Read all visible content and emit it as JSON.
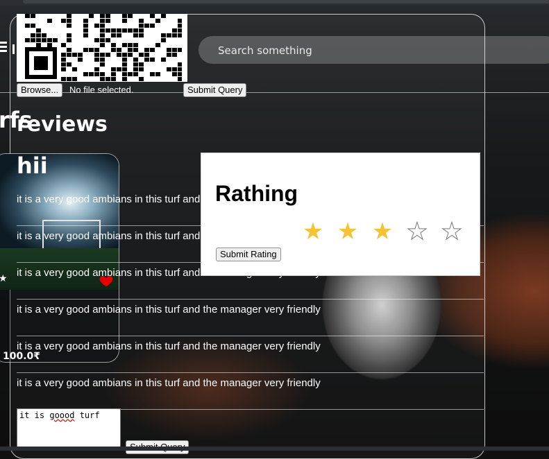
{
  "header": {
    "search_placeholder": "Search something"
  },
  "upload": {
    "browse_label": "Browse...",
    "file_status": "No file selected.",
    "submit_label": "Submit Query"
  },
  "sections": {
    "turfs_title": "rfs",
    "reviews_title": "reviews"
  },
  "turf": {
    "name": "hii",
    "price": "100.0₹",
    "favorite_icon": "heart-icon"
  },
  "reviews": [
    {
      "text": "it is a very good ambians in this turf and the manager very friendly"
    },
    {
      "text": "it is a very good ambians in this turf and the manager very friendly"
    },
    {
      "text": "it is a very good ambians in this turf and the manager very friendly"
    },
    {
      "text": "it is a very good ambians in this turf and the manager very friendly"
    },
    {
      "text": "it is a very good ambians in this turf and the manager very friendly"
    },
    {
      "text": "it is a very good ambians in this turf and the manager very friendly"
    }
  ],
  "rating": {
    "title": "Rathing",
    "value": 3,
    "max": 5,
    "submit_label": "Submit Rating",
    "star_color": "#f6c237"
  },
  "review_form": {
    "value_before": "it is ",
    "value_misspelled": "goood",
    "value_after": " turf",
    "submit_label": "Submit Query"
  }
}
